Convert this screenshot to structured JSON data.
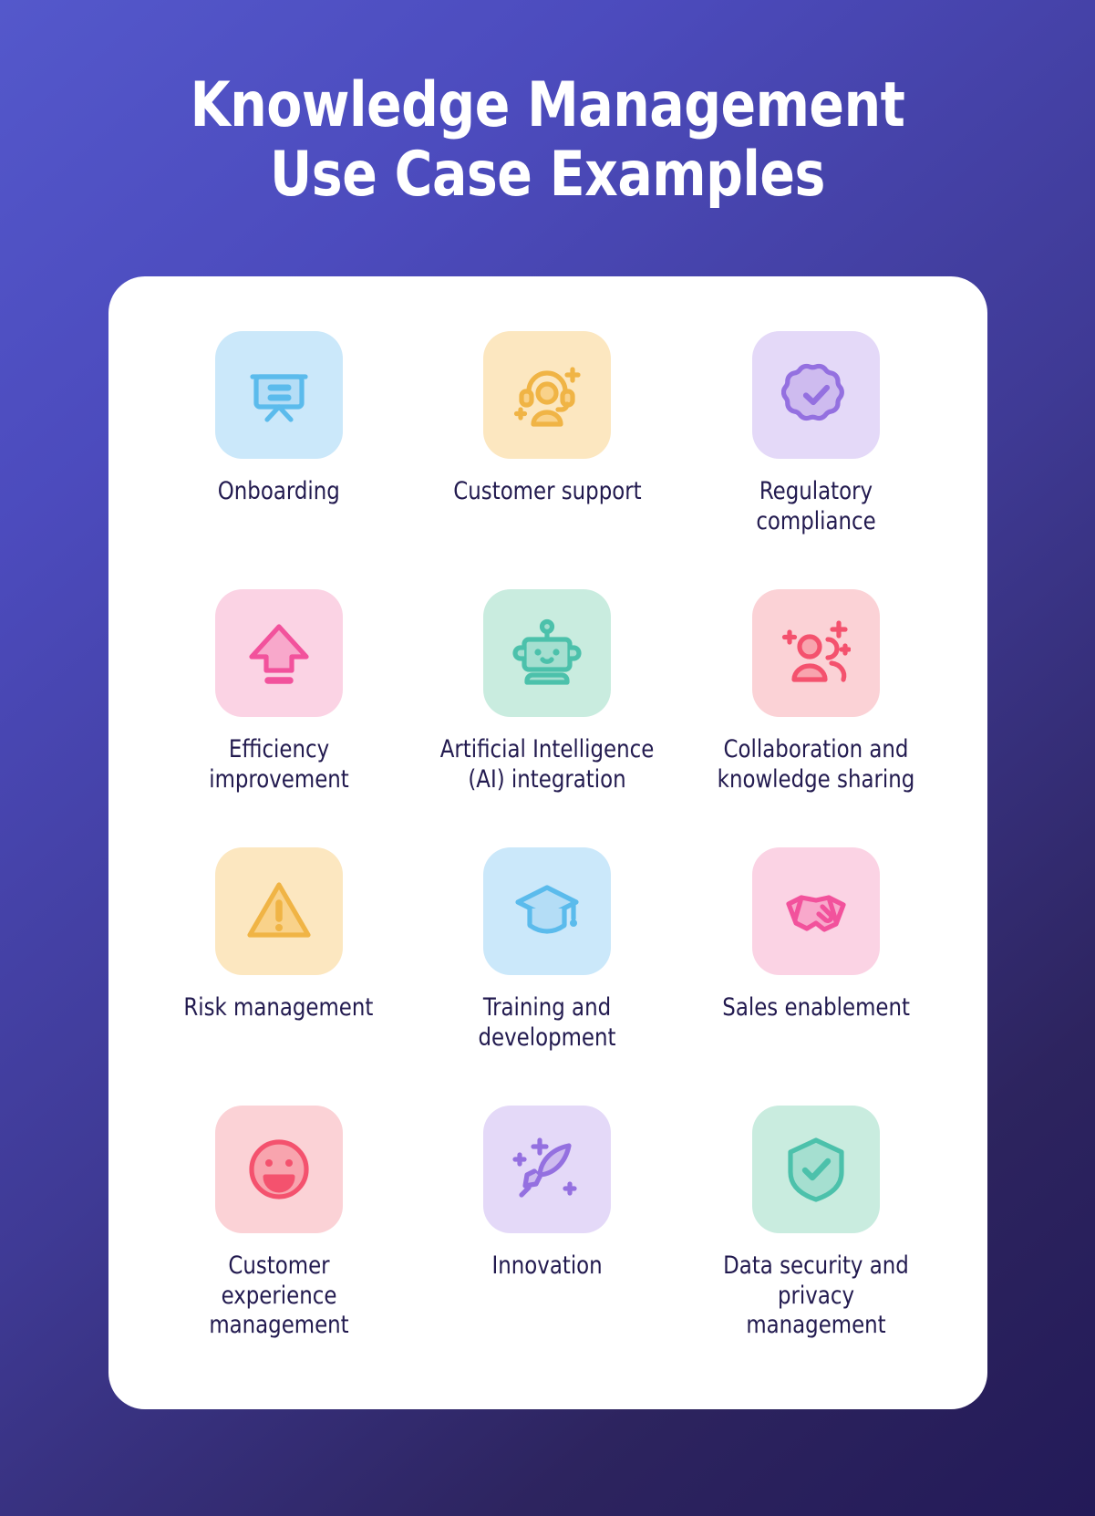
{
  "title": {
    "line1": "Knowledge Management",
    "line2": "Use Case Examples"
  },
  "theme": {
    "background_start": "#5458cb",
    "background_end": "#231a58",
    "card_background": "#ffffff",
    "label_color": "#221a4f",
    "title_color": "#ffffff"
  },
  "grid": {
    "columns": 3,
    "rows": 4,
    "items": [
      {
        "label": "Onboarding",
        "icon": "presentation-board-icon",
        "tile_color": "#cbe8fa",
        "icon_color": "#5bbbec",
        "icon_fill": "#b4ddf6"
      },
      {
        "label": "Customer support",
        "icon": "support-agent-headset-icon",
        "tile_color": "#fce7c0",
        "icon_color": "#f0b445",
        "icon_fill": "#f9d28a"
      },
      {
        "label": "Regulatory compliance",
        "icon": "verified-badge-check-icon",
        "tile_color": "#e4d9f8",
        "icon_color": "#9470e0",
        "icon_fill": "#cebbef"
      },
      {
        "label": "Efficiency improvement",
        "icon": "upload-arrow-up-icon",
        "tile_color": "#fbd3e4",
        "icon_color": "#f2529c",
        "icon_fill": "#f8a8cb"
      },
      {
        "label": "Artificial Intelligence (AI) integration",
        "icon": "robot-head-icon",
        "tile_color": "#c9ecdf",
        "icon_color": "#4cc1ab",
        "icon_fill": "#a5dfd0"
      },
      {
        "label": "Collaboration and knowledge sharing",
        "icon": "people-group-sparkle-icon",
        "tile_color": "#fbd2d6",
        "icon_color": "#f4526e",
        "icon_fill": "#f8a4ae"
      },
      {
        "label": "Risk management",
        "icon": "warning-triangle-icon",
        "tile_color": "#fce7c0",
        "icon_color": "#f0b445",
        "icon_fill": "#f9d28a"
      },
      {
        "label": "Training and development",
        "icon": "graduation-cap-icon",
        "tile_color": "#cbe8fa",
        "icon_color": "#5bbbec",
        "icon_fill": "#b4ddf6"
      },
      {
        "label": "Sales enablement",
        "icon": "handshake-icon",
        "tile_color": "#fbd3e4",
        "icon_color": "#f2529c",
        "icon_fill": "#f8a8cb"
      },
      {
        "label": "Customer experience management",
        "icon": "smiley-face-icon",
        "tile_color": "#fbd2d6",
        "icon_color": "#f4526e",
        "icon_fill": "#f8a4ae"
      },
      {
        "label": "Innovation",
        "icon": "rocket-sparkle-icon",
        "tile_color": "#e4d9f8",
        "icon_color": "#9470e0",
        "icon_fill": "#cebbef"
      },
      {
        "label": "Data security and privacy management",
        "icon": "shield-check-icon",
        "tile_color": "#c9ecdf",
        "icon_color": "#4cc1ab",
        "icon_fill": "#a5dfd0"
      }
    ]
  }
}
